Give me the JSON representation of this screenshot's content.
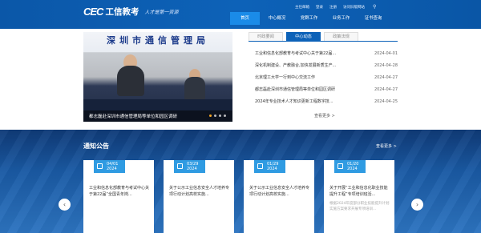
{
  "header": {
    "logo_mark": "CEC",
    "logo_name": "工信教考",
    "logo_slogan": "人才是第一资源",
    "top_links": [
      "主任邮箱",
      "登录",
      "注册",
      "访问旧版网站"
    ],
    "nav": [
      {
        "label": "首页",
        "active": true
      },
      {
        "label": "中心概况",
        "active": false
      },
      {
        "label": "党群工作",
        "active": false
      },
      {
        "label": "业务工作",
        "active": false
      },
      {
        "label": "证书查询",
        "active": false
      }
    ]
  },
  "banner": {
    "sign_text": "深圳市通信管理局",
    "caption": "都志磊赴深圳市通信管理局等单位和园区调研",
    "slides": 4,
    "active_slide": 1
  },
  "news": {
    "tabs": [
      {
        "label": "时政要闻",
        "active": false
      },
      {
        "label": "中心动态",
        "active": true
      },
      {
        "label": "政策法规",
        "active": false
      }
    ],
    "items": [
      {
        "title": "工业和信息化部教育与考试中心关于第22届...",
        "date": "2024-04-01"
      },
      {
        "title": "深化机制建设、产教融合,加快发展新质生产...",
        "date": "2024-04-28"
      },
      {
        "title": "北京理工大学一行到中心交流工作",
        "date": "2024-04-27"
      },
      {
        "title": "都志磊赴深圳市通信管理局等单位和园区调研",
        "date": "2024-04-27"
      },
      {
        "title": "2024年专业技术人才知识更新工程数字技...",
        "date": "2024-04-25"
      }
    ],
    "more_label": "查看更多 >"
  },
  "notices": {
    "title": "通知公告",
    "more_label": "查看更多 >",
    "cards": [
      {
        "date_md": "04/01",
        "year": "2024",
        "text": "工业和信息化部教育与考试中心关于第22届“全国青年岗..."
      },
      {
        "date_md": "03/29",
        "year": "2024",
        "text": "关于公示工业信息安全人才培养专项行动计划高校实施..."
      },
      {
        "date_md": "01/29",
        "year": "2024",
        "text": "关于公示工业信息安全人才培养专项行动计划高校实施..."
      },
      {
        "date_md": "01/20",
        "year": "2024",
        "text": "关于开展“工业和信息化职业技能提升工程”专项培训班活...",
        "faded": "根据2024年度部分职业技能提升计划实施方案要求开展专项培训..."
      }
    ],
    "prev_icon": "chevron-left-icon",
    "next_icon": "chevron-right-icon"
  }
}
